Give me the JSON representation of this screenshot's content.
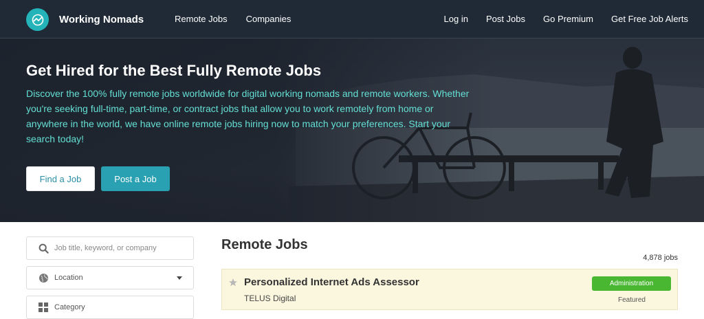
{
  "header": {
    "brand": "Working Nomads",
    "nav_left": [
      "Remote Jobs",
      "Companies"
    ],
    "nav_right": [
      "Log in",
      "Post Jobs",
      "Go Premium",
      "Get Free Job Alerts"
    ]
  },
  "hero": {
    "title": "Get Hired for the Best Fully Remote Jobs",
    "description": "Discover the 100% fully remote jobs worldwide for digital working nomads and remote workers. Whether you're seeking full-time, part-time, or contract jobs that allow you to work remotely from home or anywhere in the world, we have online remote jobs hiring now to match your preferences. Start your search today!",
    "find_button": "Find a Job",
    "post_button": "Post a Job"
  },
  "filters": {
    "search_placeholder": "Job title, keyword, or company",
    "location_label": "Location",
    "category_label": "Category"
  },
  "main": {
    "title": "Remote Jobs",
    "count": "4,878 jobs",
    "jobs": [
      {
        "title": "Personalized Internet Ads Assessor",
        "company": "TELUS Digital",
        "tag": "Administration",
        "featured": "Featured"
      }
    ]
  },
  "colors": {
    "header_bg": "#1f2a36",
    "brand_accent": "#23b3b8",
    "hero_text": "#64dfd4",
    "post_button": "#2aa1b2",
    "tag_green": "#4ab733",
    "featured_card": "#fbf7de"
  },
  "icons": [
    "logo-icon",
    "search-icon",
    "globe-icon",
    "grid-icon",
    "star-icon",
    "chevron-down-icon"
  ]
}
